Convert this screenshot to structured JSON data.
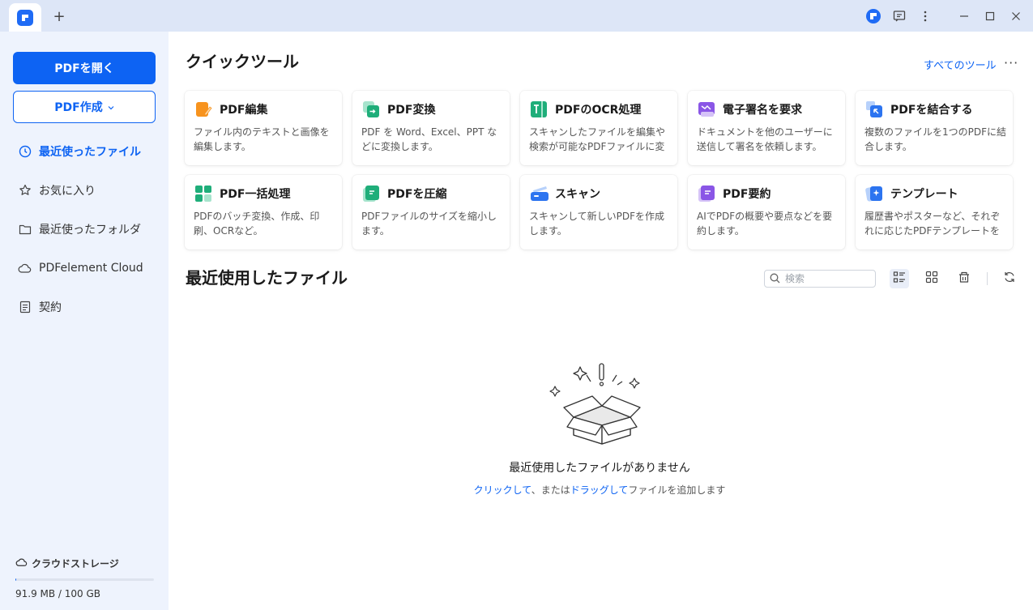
{
  "titlebar": {
    "tab_icon": "pdfelement-logo-icon",
    "new_tab": "+",
    "right_icons": [
      "account-icon",
      "feedback-icon",
      "more-vert-icon",
      "minimize-icon",
      "maximize-icon",
      "close-icon"
    ]
  },
  "sidebar": {
    "open_pdf": "PDFを開く",
    "create_pdf": "PDF作成",
    "nav": [
      {
        "label": "最近使ったファイル",
        "icon": "clock-icon",
        "active": true
      },
      {
        "label": "お気に入り",
        "icon": "star-icon",
        "active": false
      },
      {
        "label": "最近使ったフォルダ",
        "icon": "folder-icon",
        "active": false
      },
      {
        "label": "PDFelement Cloud",
        "icon": "cloud-icon",
        "active": false
      },
      {
        "label": "契約",
        "icon": "document-icon",
        "active": false
      }
    ],
    "storage": {
      "label": "クラウドストレージ",
      "usage": "91.9 MB / 100 GB",
      "used_fraction": 0.0009
    }
  },
  "quick_tools": {
    "title": "クイックツール",
    "all_tools": "すべてのツール",
    "more": "···",
    "cards": [
      {
        "title": "PDF編集",
        "desc": "ファイル内のテキストと画像を編集します。",
        "icon": "edit-pdf-icon"
      },
      {
        "title": "PDF変換",
        "desc": "PDF を Word、Excel、PPT などに変換します。",
        "icon": "convert-pdf-icon"
      },
      {
        "title": "PDFのOCR処理",
        "desc": "スキャンしたファイルを編集や検索が可能なPDFファイルに変換します。",
        "icon": "ocr-icon"
      },
      {
        "title": "電子署名を要求",
        "desc": "ドキュメントを他のユーザーに送信して署名を依頼します。",
        "icon": "esign-icon"
      },
      {
        "title": "PDFを結合する",
        "desc": "複数のファイルを1つのPDFに結合します。",
        "icon": "combine-icon"
      },
      {
        "title": "PDF一括処理",
        "desc": "PDFのバッチ変換、作成、印刷、OCRなど。",
        "icon": "batch-icon"
      },
      {
        "title": "PDFを圧縮",
        "desc": "PDFファイルのサイズを縮小します。",
        "icon": "compress-icon"
      },
      {
        "title": "スキャン",
        "desc": "スキャンして新しいPDFを作成します。",
        "icon": "scan-icon"
      },
      {
        "title": "PDF要約",
        "desc": "AIでPDFの概要や要点などを要約します。",
        "icon": "summarize-icon"
      },
      {
        "title": "テンプレート",
        "desc": "履歴書やポスターなど、それぞれに応じたPDFテンプレートを提供します。",
        "icon": "template-icon"
      }
    ]
  },
  "recent": {
    "title": "最近使用したファイル",
    "search_placeholder": "検索",
    "view_buttons": [
      "list-view-icon",
      "grid-view-icon",
      "delete-icon",
      "refresh-icon"
    ],
    "empty_title": "最近使用したファイルがありません",
    "empty_click": "クリックして",
    "empty_mid": "、または",
    "empty_drag": "ドラッグして",
    "empty_end": "ファイルを追加します"
  },
  "colors": {
    "accent": "#0d63f3",
    "sidebar_bg": "#eef3fd",
    "titlebar_bg": "#dde6f7"
  }
}
